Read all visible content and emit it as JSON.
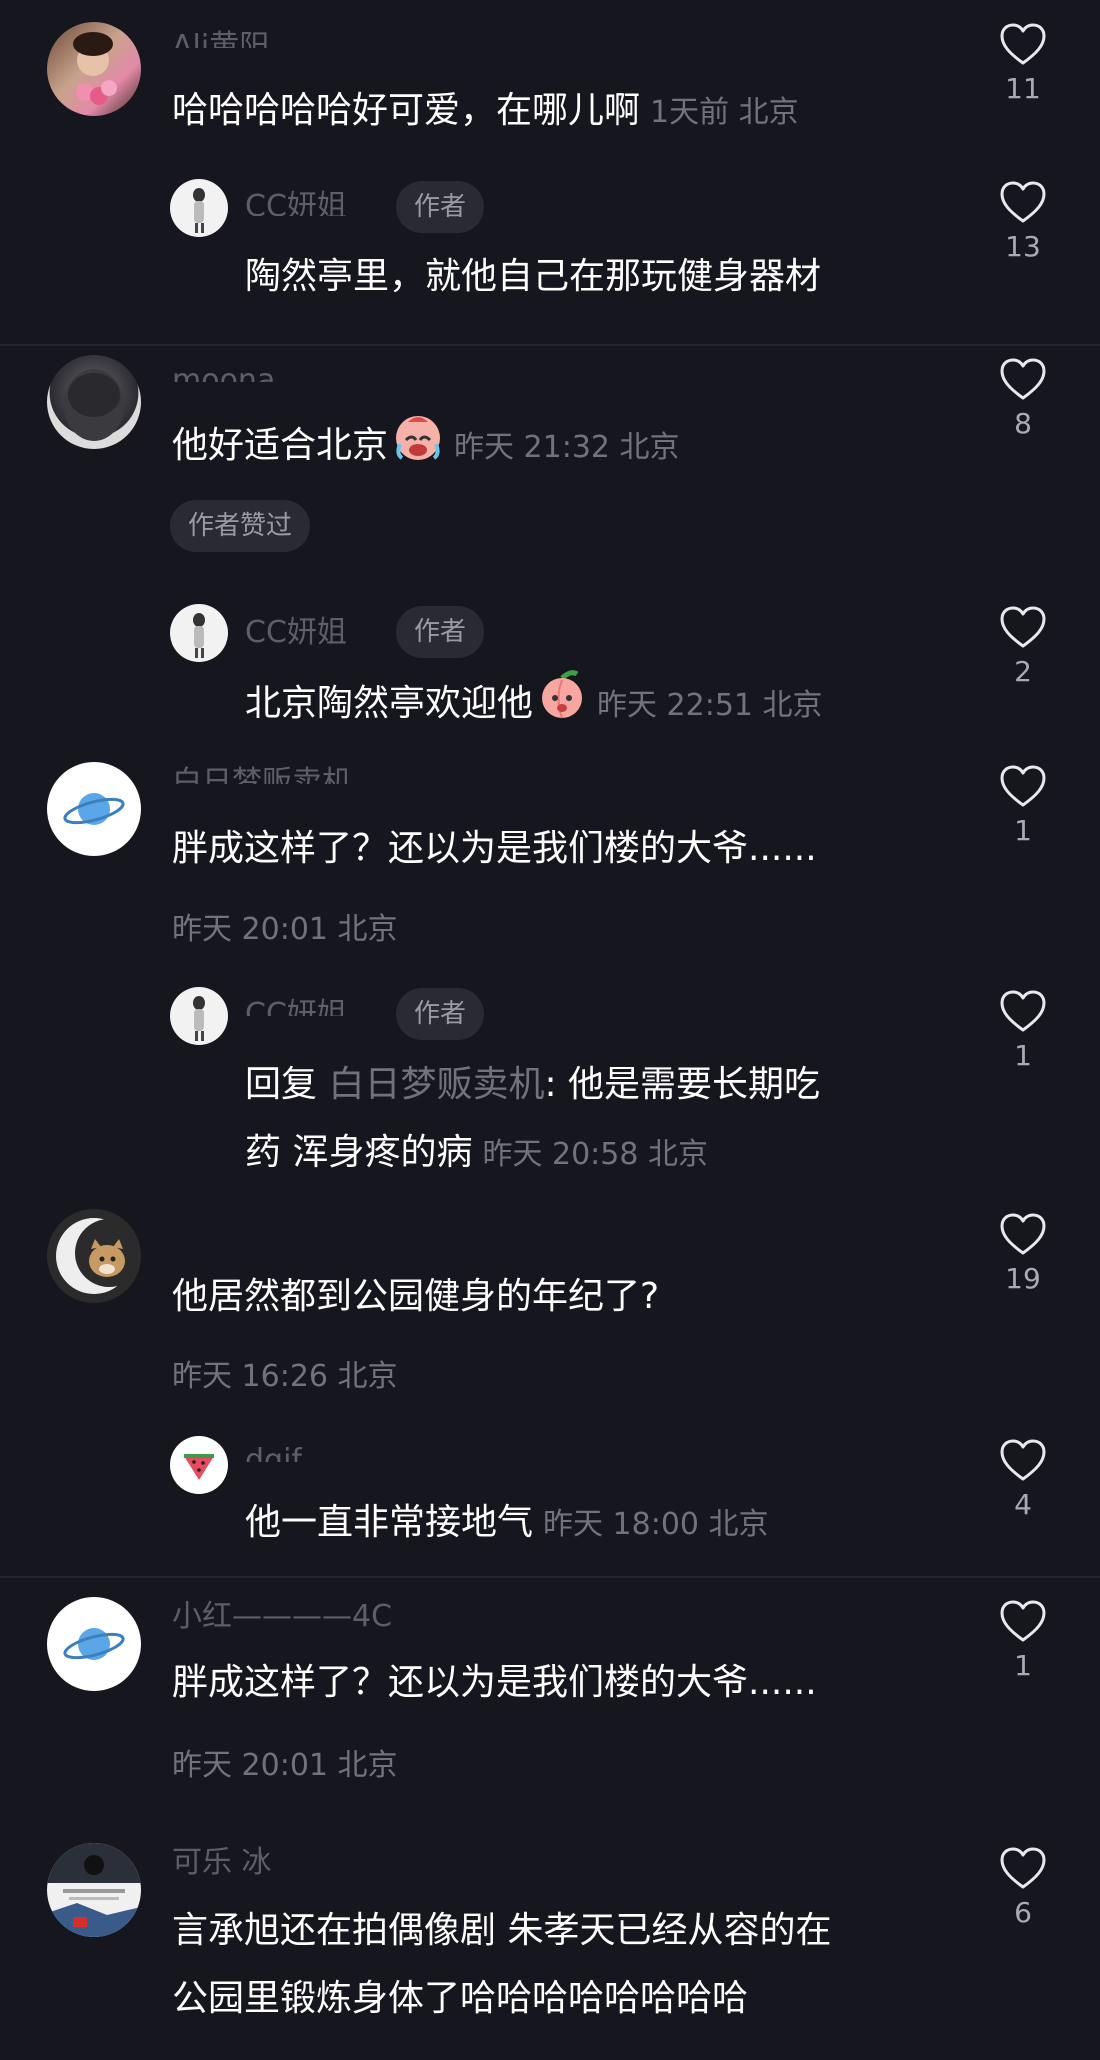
{
  "comments": [
    {
      "username": "Ali黄阳",
      "text": "哈哈哈哈哈好可爱，在哪儿啊",
      "meta": "1天前 北京",
      "likes": "11",
      "replies": [
        {
          "username": "CC妍姐",
          "badge": "作者",
          "text": "陶然亭里，就他自己在那玩健身器材",
          "meta": "",
          "likes": "13"
        }
      ]
    },
    {
      "username": "moona_",
      "text": "他好适合北京",
      "meta": "昨天 21:32 北京",
      "likes": "8",
      "author_liked": "作者赞过",
      "replies": [
        {
          "username": "CC妍姐",
          "badge": "作者",
          "text": "北京陶然亭欢迎他",
          "meta": "昨天 22:51 北京",
          "likes": "2"
        }
      ]
    },
    {
      "username": "白日梦贩卖机",
      "text": "胖成这样了？还以为是我们楼的大爷......",
      "meta": "昨天 20:01 北京",
      "likes": "1",
      "replies": [
        {
          "username": "CC妍姐",
          "badge": "作者",
          "reply_prefix": "回复",
          "reply_to": "白日梦贩卖机",
          "text_line1": ": 他是需要长期吃",
          "text_line2": "药 浑身疼的病",
          "meta": "昨天 20:58 北京",
          "likes": "1"
        }
      ]
    },
    {
      "username": "",
      "text": "他居然都到公园健身的年纪了?",
      "meta": "昨天 16:26 北京",
      "likes": "19",
      "replies": [
        {
          "username": "dgif",
          "text": "他一直非常接地气",
          "meta": "昨天 18:00 北京",
          "likes": "4"
        }
      ]
    },
    {
      "username": "小红————4C",
      "text": "胖成这样了？还以为是我们楼的大爷......",
      "meta": "昨天 20:01 北京",
      "likes": "1"
    },
    {
      "username": "可乐 冰",
      "text_line1": "言承旭还在拍偶像剧 朱孝天已经从容的在",
      "text_line2": "公园里锻炼身体了哈哈哈哈哈哈哈哈",
      "likes": "6"
    }
  ],
  "colors": {
    "background": "#16161e",
    "text": "#ffffff",
    "meta": "#72727c",
    "badge_bg": "#2a2a33"
  }
}
